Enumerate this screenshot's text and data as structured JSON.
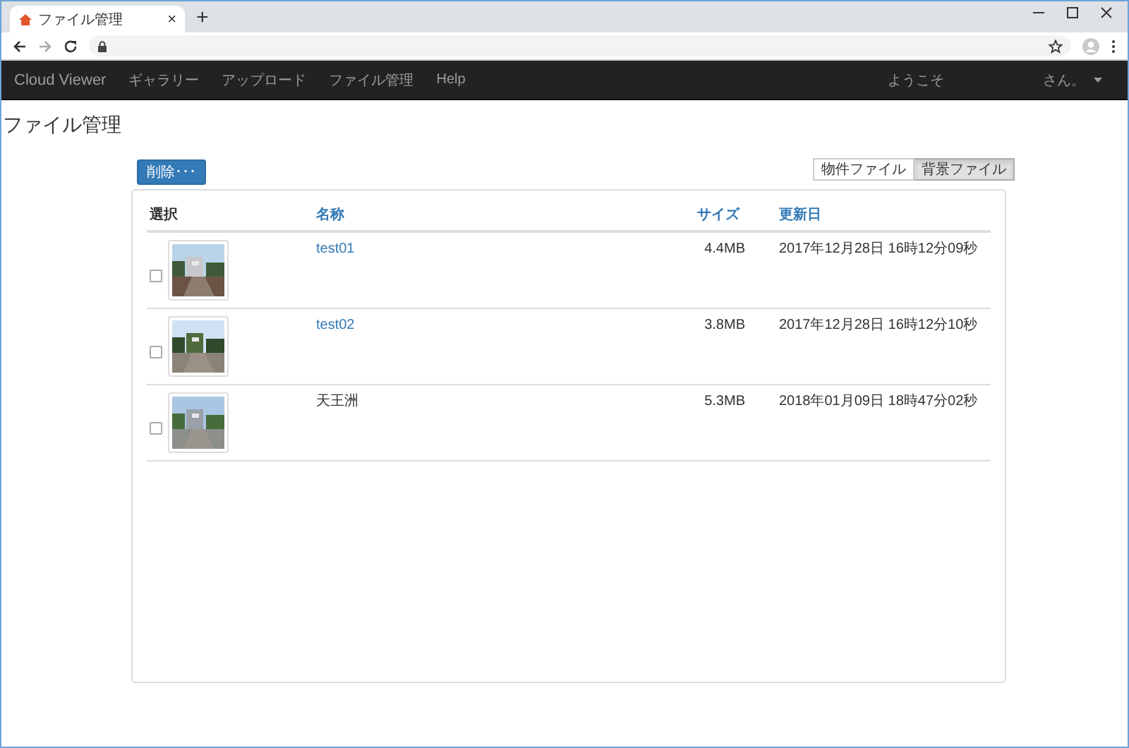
{
  "browser": {
    "tab_title": "ファイル管理",
    "new_tab": "+",
    "tab_close": "×"
  },
  "navbar": {
    "brand": "Cloud Viewer",
    "items": [
      "ギャラリー",
      "アップロード",
      "ファイル管理",
      "Help"
    ],
    "welcome": "ようこそ",
    "user": "さん。"
  },
  "page": {
    "title": "ファイル管理"
  },
  "delete_button": "削除･･･",
  "file_type_toggle": [
    {
      "label": "物件ファイル",
      "selected": false
    },
    {
      "label": "背景ファイル",
      "selected": true
    }
  ],
  "table": {
    "columns": [
      {
        "label": "選択",
        "kind": "plain"
      },
      {
        "label": "名称",
        "kind": "link"
      },
      {
        "label": "サイズ",
        "kind": "link"
      },
      {
        "label": "更新日",
        "kind": "link"
      }
    ],
    "rows": [
      {
        "checked": false,
        "name": "test01",
        "name_is_link": true,
        "size": "4.4MB",
        "updated": "2017年12月28日 16時12分09秒"
      },
      {
        "checked": false,
        "name": "test02",
        "name_is_link": true,
        "size": "3.8MB",
        "updated": "2017年12月28日 16時12分10秒"
      },
      {
        "checked": false,
        "name": "天王洲",
        "name_is_link": false,
        "size": "5.3MB",
        "updated": "2018年01月09日 18時47分02秒"
      }
    ]
  }
}
